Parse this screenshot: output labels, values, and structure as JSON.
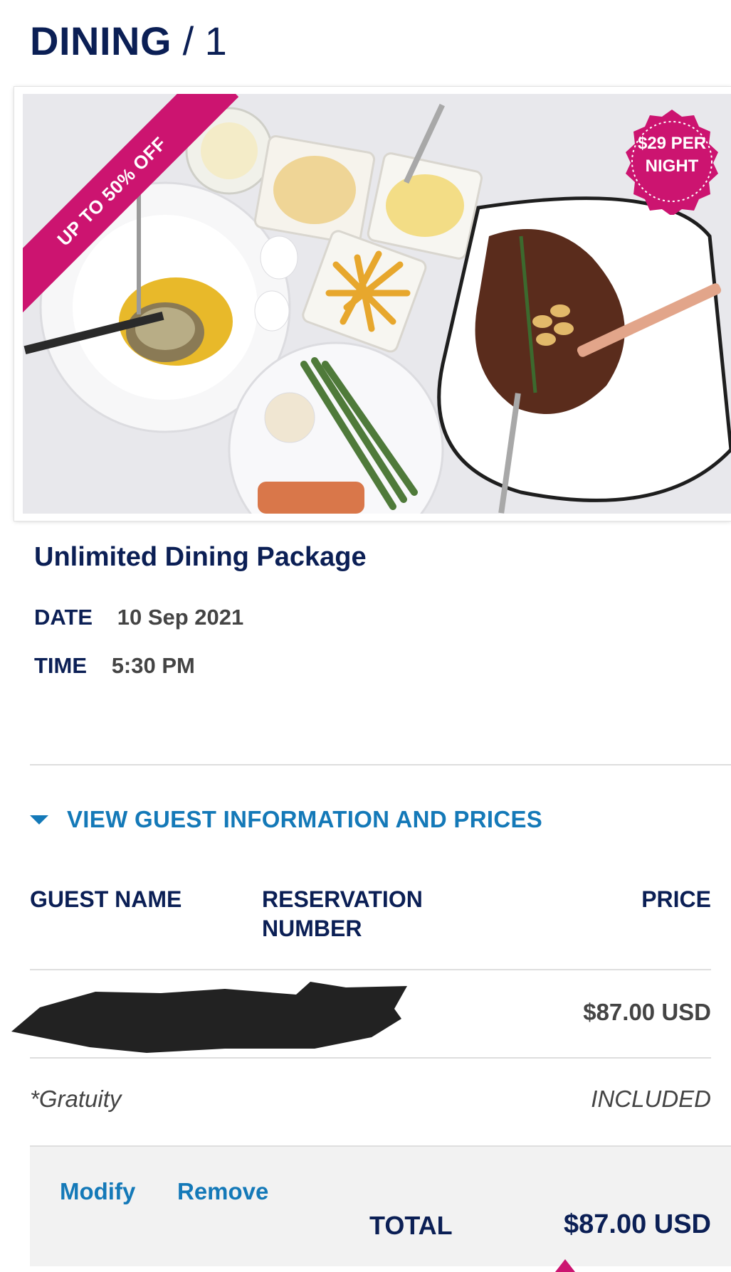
{
  "header": {
    "category": "DINING",
    "count": "/ 1"
  },
  "image": {
    "ribbon": "UP TO 50% OFF",
    "seal_line1": "$29 PER",
    "seal_line2": "NIGHT",
    "accent_color": "#cc1470"
  },
  "package": {
    "title": "Unlimited Dining Package",
    "date_label": "DATE",
    "date_value": "10 Sep 2021",
    "time_label": "TIME",
    "time_value": "5:30 PM"
  },
  "guest_section": {
    "toggle_label": "VIEW GUEST INFORMATION AND PRICES",
    "columns": {
      "guest_name": "GUEST NAME",
      "reservation_line1": "RESERVATION",
      "reservation_line2": "NUMBER",
      "price": "PRICE"
    },
    "rows": [
      {
        "price": "$87.00 USD"
      }
    ],
    "gratuity_label": "*Gratuity",
    "gratuity_value": "INCLUDED"
  },
  "footer": {
    "modify_label": "Modify",
    "remove_label": "Remove",
    "total_label": "TOTAL",
    "total_value": "$87.00 USD"
  },
  "colors": {
    "navy": "#0b1f55",
    "link_blue": "#1479b8",
    "brand_pink": "#cc1470"
  }
}
